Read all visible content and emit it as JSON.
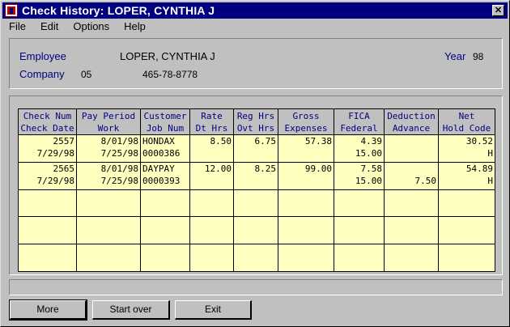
{
  "window": {
    "title": "Check History:  LOPER, CYNTHIA J",
    "close_glyph": "✕"
  },
  "menu": [
    "File",
    "Edit",
    "Options",
    "Help"
  ],
  "info": {
    "employee_label": "Employee",
    "employee_name": "LOPER, CYNTHIA J",
    "company_label": "Company",
    "company_code": "05",
    "ssn": "465-78-8778",
    "year_label": "Year",
    "year_value": "98"
  },
  "table": {
    "headers": [
      [
        "Check Num",
        "Check Date"
      ],
      [
        "Pay Period",
        "Work"
      ],
      [
        "Customer",
        "Job Num"
      ],
      [
        "Rate",
        "Dt Hrs"
      ],
      [
        "Reg Hrs",
        "Ovt Hrs"
      ],
      [
        "Gross",
        "Expenses"
      ],
      [
        "FICA",
        "Federal"
      ],
      [
        "Deduction",
        "Advance"
      ],
      [
        "Net",
        "Hold Code"
      ]
    ],
    "rows": [
      [
        [
          "2557",
          "7/29/98"
        ],
        [
          "8/01/98",
          "7/25/98"
        ],
        [
          "HONDAX",
          "0000386"
        ],
        [
          "8.50",
          ""
        ],
        [
          "6.75",
          ""
        ],
        [
          "57.38",
          ""
        ],
        [
          "4.39",
          "15.00"
        ],
        [
          "",
          ""
        ],
        [
          "30.52",
          "H"
        ]
      ],
      [
        [
          "2565",
          "7/29/98"
        ],
        [
          "8/01/98",
          "7/25/98"
        ],
        [
          "DAYPAY",
          "0000393"
        ],
        [
          "12.00",
          ""
        ],
        [
          "8.25",
          ""
        ],
        [
          "99.00",
          ""
        ],
        [
          "7.58",
          "15.00"
        ],
        [
          "",
          "7.50"
        ],
        [
          "54.89",
          "H"
        ]
      ],
      [
        [
          "",
          ""
        ],
        [
          "",
          ""
        ],
        [
          "",
          ""
        ],
        [
          "",
          ""
        ],
        [
          "",
          ""
        ],
        [
          "",
          ""
        ],
        [
          "",
          ""
        ],
        [
          "",
          ""
        ],
        [
          "",
          ""
        ]
      ],
      [
        [
          "",
          ""
        ],
        [
          "",
          ""
        ],
        [
          "",
          ""
        ],
        [
          "",
          ""
        ],
        [
          "",
          ""
        ],
        [
          "",
          ""
        ],
        [
          "",
          ""
        ],
        [
          "",
          ""
        ],
        [
          "",
          ""
        ]
      ],
      [
        [
          "",
          ""
        ],
        [
          "",
          ""
        ],
        [
          "",
          ""
        ],
        [
          "",
          ""
        ],
        [
          "",
          ""
        ],
        [
          "",
          ""
        ],
        [
          "",
          ""
        ],
        [
          "",
          ""
        ],
        [
          "",
          ""
        ]
      ]
    ]
  },
  "status_text": "",
  "buttons": {
    "more": "More",
    "start_over": "Start over",
    "exit": "Exit"
  }
}
